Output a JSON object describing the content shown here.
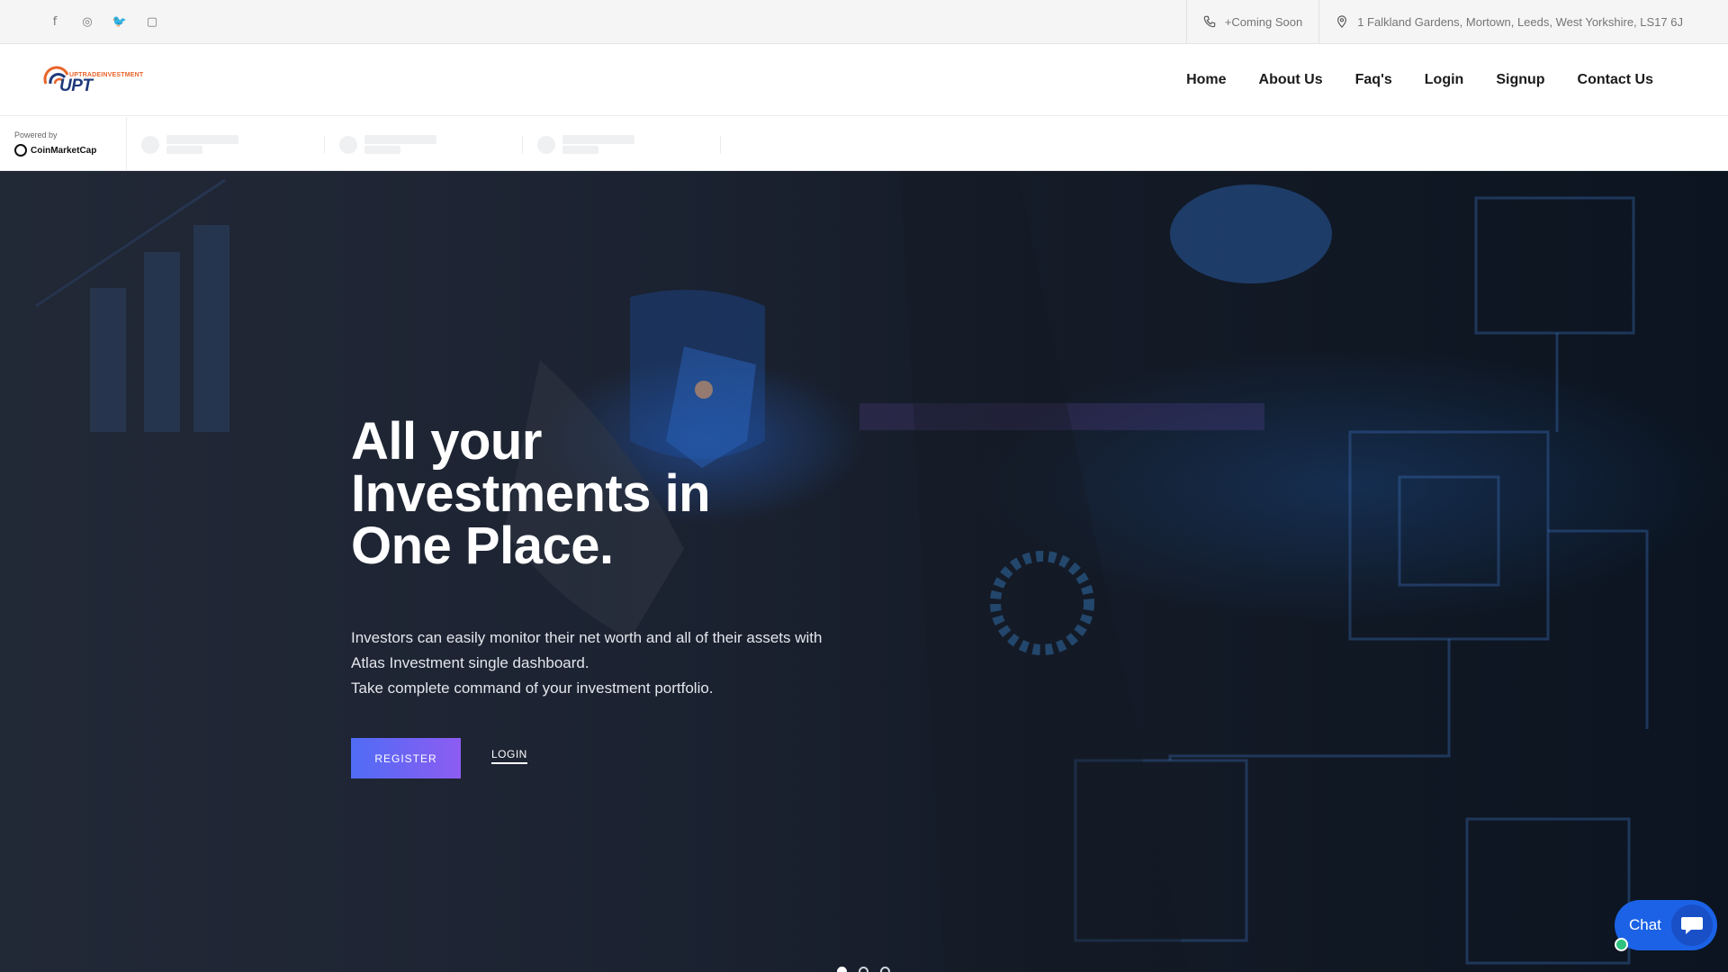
{
  "social": [
    {
      "icon": "facebook-icon",
      "glyph": "f"
    },
    {
      "icon": "dribbble-icon",
      "glyph": "◎"
    },
    {
      "icon": "twitter-icon",
      "glyph": "🐦"
    },
    {
      "icon": "instagram-icon",
      "glyph": "▢"
    }
  ],
  "contact": {
    "phone": "+Coming Soon",
    "address": "1 Falkland Gardens, Mortown, Leeds, West Yorkshire, LS17 6J"
  },
  "brand": {
    "small": "UPTRADEINVESTMENT",
    "big": "UPT",
    "colors": {
      "accent": "#e8642a",
      "primary": "#1e3a7a"
    }
  },
  "nav": [
    "Home",
    "About Us",
    "Faq's",
    "Login",
    "Signup",
    "Contact Us"
  ],
  "ticker": {
    "powered_by": "Powered by",
    "provider": "CoinMarketCap"
  },
  "hero": {
    "headline_lines": [
      "All your",
      "Investments in",
      "One Place."
    ],
    "description_lines": [
      "Investors can easily monitor their net worth and all of their assets with",
      "Atlas Investment single dashboard.",
      "Take complete command of your investment portfolio."
    ],
    "register_label": "REGISTER",
    "login_label": "LOGIN",
    "slides_total": 3,
    "slide_active": 1
  },
  "chat": {
    "label": "Chat",
    "accent": "#1b62e6"
  }
}
